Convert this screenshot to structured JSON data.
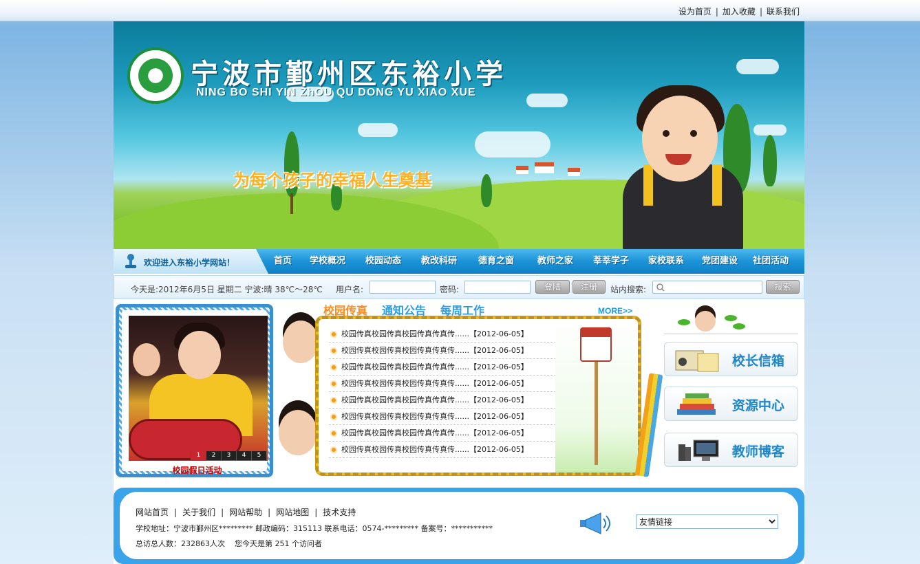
{
  "topbar": {
    "links": [
      "设为首页",
      "加入收藏",
      "联系我们"
    ]
  },
  "banner": {
    "title_cn": "宁波市鄞州区东裕小学",
    "title_en": "NING BO SHI YIN ZhOU QU DONG YU XIAO XUE",
    "slogan": "为每个孩子的幸福人生奠基"
  },
  "nav": {
    "welcome": "欢迎进入东裕小学网站！",
    "items": [
      "首页",
      "学校概况",
      "校园动态",
      "教改科研",
      "德育之窗",
      "教师之家",
      "莘莘学子",
      "家校联系",
      "党团建设",
      "社团活动"
    ]
  },
  "infobar": {
    "date_text": "今天是:2012年6月5日 星期二 宁波:晴 38℃～28℃",
    "username_label": "用户名:",
    "password_label": "密码:",
    "login_button": "登陆",
    "register_button": "注册",
    "search_label": "站内搜索:",
    "search_button": "搜索"
  },
  "photo": {
    "caption": "校园假日活动",
    "pages": [
      "1",
      "2",
      "3",
      "4",
      "5"
    ],
    "active_page": "1"
  },
  "news": {
    "tabs": [
      "校园传真",
      "通知公告",
      "每周工作"
    ],
    "more": "MORE>>",
    "items": [
      {
        "title": "校园传真校园传真校园传真传真传......",
        "date": "【2012-06-05】"
      },
      {
        "title": "校园传真校园传真校园传真传真传......",
        "date": "【2012-06-05】"
      },
      {
        "title": "校园传真校园传真校园传真传真传......",
        "date": "【2012-06-05】"
      },
      {
        "title": "校园传真校园传真校园传真传真传......",
        "date": "【2012-06-05】"
      },
      {
        "title": "校园传真校园传真校园传真传真传......",
        "date": "【2012-06-05】"
      },
      {
        "title": "校园传真校园传真校园传真传真传......",
        "date": "【2012-06-05】"
      },
      {
        "title": "校园传真校园传真校园传真传真传......",
        "date": "【2012-06-05】"
      },
      {
        "title": "校园传真校园传真校园传真传真传......",
        "date": "【2012-06-05】"
      }
    ]
  },
  "sidebar": {
    "buttons": [
      "校长信箱",
      "资源中心",
      "教师博客"
    ]
  },
  "footer": {
    "links": [
      "网站首页",
      "关于我们",
      "网站帮助",
      "网站地图",
      "技术支持"
    ],
    "address": "学校地址：宁波市鄞州区********* 邮政编码：315113 联系电话：0574-********* 备案号：***********",
    "visits": "总访总人数：232863人次    您今天是第 251 个访问者",
    "friend_links": "友情链接"
  },
  "colors": {
    "nav_blue": "#1c93d8",
    "accent_orange": "#ff8a1a",
    "frame_yellow": "#f2b820",
    "footer_blue": "#3aa4ea"
  }
}
